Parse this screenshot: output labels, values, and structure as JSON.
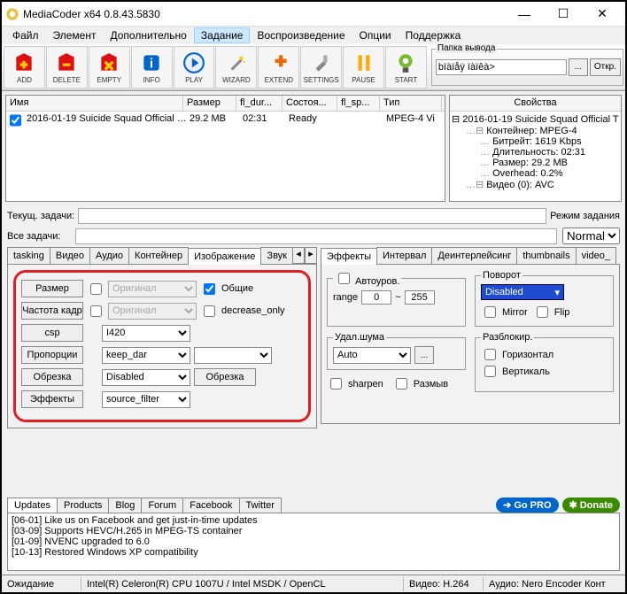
{
  "window": {
    "title": "MediaCoder x64 0.8.43.5830"
  },
  "menu": {
    "items": [
      "Файл",
      "Элемент",
      "Дополнительно",
      "Задание",
      "Воспроизведение",
      "Опции",
      "Поддержка"
    ],
    "active_index": 3
  },
  "toolbar": {
    "buttons": [
      "ADD",
      "DELETE",
      "EMPTY",
      "INFO",
      "PLAY",
      "WIZARD",
      "EXTEND",
      "SETTINGS",
      "PAUSE",
      "START"
    ],
    "output": {
      "legend": "Папка вывода",
      "value": "bïàïåÿ ïàïêà>",
      "browse": "...",
      "open": "Откр."
    }
  },
  "filelist": {
    "headers": {
      "name": "Имя",
      "size": "Размер",
      "dur": "fl_dur...",
      "state": "Состоя...",
      "sp": "fl_sp...",
      "type": "Тип"
    },
    "rows": [
      {
        "name": "2016-01-19 Suicide Squad Official …",
        "size": "29.2 MB",
        "dur": "02:31",
        "state": "Ready",
        "sp": "",
        "type": "MPEG-4 Vi"
      }
    ]
  },
  "props": {
    "title": "Свойства",
    "root": "2016-01-19 Suicide Squad Official T",
    "container_label": "Контейнер: MPEG-4",
    "lines": [
      "Битрейт: 1619 Kbps",
      "Длительность: 02:31",
      "Размер: 29.2 MB",
      "Overhead: 0.2%"
    ],
    "video_line": "Видео (0): AVC"
  },
  "tasks": {
    "current_label": "Текущ. задачи:",
    "all_label": "Все задачи:",
    "mode_label": "Режим задания",
    "mode_value": "Normal"
  },
  "left_tabs": {
    "items": [
      "tasking",
      "Видео",
      "Аудио",
      "Контейнер",
      "Изображение",
      "Звук"
    ],
    "active_index": 4
  },
  "image_tab": {
    "size": {
      "label": "Размер",
      "value": "Оригинал",
      "common": "Общие"
    },
    "framerate": {
      "label": "Частота кадр",
      "value": "Оригинал",
      "decrease": "decrease_only"
    },
    "csp": {
      "label": "csp",
      "value": "I420"
    },
    "aspect": {
      "label": "Пропорции",
      "value": "keep_dar"
    },
    "crop": {
      "label": "Обрезка",
      "value": "Disabled",
      "button": "Обрезка"
    },
    "effects": {
      "label": "Эффекты",
      "value": "source_filter"
    }
  },
  "right_tabs": {
    "items": [
      "Эффекты",
      "Интервал",
      "Деинтерлейсинг",
      "thumbnails",
      "video_"
    ],
    "active_index": 0
  },
  "effects": {
    "autolevel": {
      "legend": "Автоуров.",
      "range_label": "range",
      "min": "0",
      "tilde": "~",
      "max": "255"
    },
    "rotate": {
      "legend": "Поворот",
      "value": "Disabled",
      "mirror": "Mirror",
      "flip": "Flip"
    },
    "denoise": {
      "legend": "Удал.шума",
      "value": "Auto",
      "more": "..."
    },
    "sharpen": "sharpen",
    "blur": "Размыв",
    "deblock": {
      "legend": "Разблокир.",
      "h": "Горизонтал",
      "v": "Вертикаль"
    }
  },
  "updates": {
    "tabs": [
      "Updates",
      "Products",
      "Blog",
      "Forum",
      "Facebook",
      "Twitter"
    ],
    "gopro": "Go PRO",
    "donate": "Donate",
    "lines": [
      "[06-01] Like us on Facebook and get just-in-time updates",
      "[03-09] Supports HEVC/H.265 in MPEG-TS container",
      "[01-09] NVENC upgraded to 6.0",
      "[10-13] Restored Windows XP compatibility"
    ]
  },
  "status": {
    "state": "Ожидание",
    "cpu": "Intel(R) Celeron(R) CPU 1007U  / Intel MSDK / OpenCL",
    "video": "Видео: H.264",
    "audio": "Аудио: Nero Encoder  Конт"
  }
}
